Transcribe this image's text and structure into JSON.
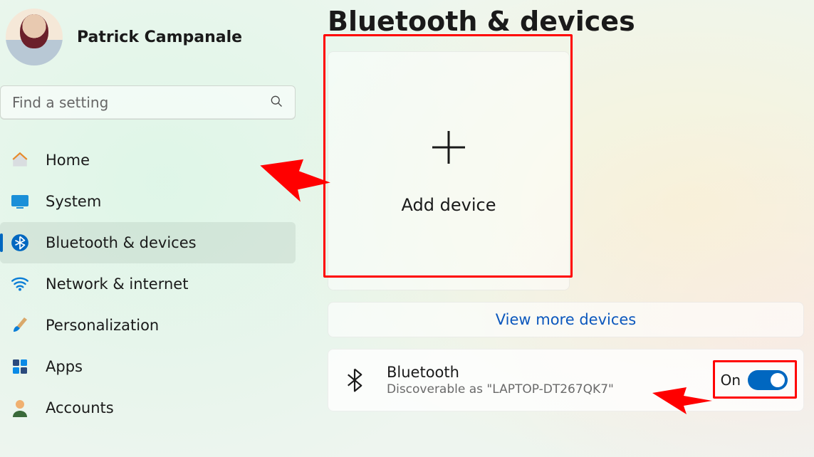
{
  "user": {
    "name": "Patrick Campanale"
  },
  "search": {
    "placeholder": "Find a setting"
  },
  "nav": {
    "items": [
      {
        "label": "Home"
      },
      {
        "label": "System"
      },
      {
        "label": "Bluetooth & devices"
      },
      {
        "label": "Network & internet"
      },
      {
        "label": "Personalization"
      },
      {
        "label": "Apps"
      },
      {
        "label": "Accounts"
      }
    ]
  },
  "page": {
    "title": "Bluetooth & devices"
  },
  "tile": {
    "addLabel": "Add device"
  },
  "viewMore": {
    "label": "View more devices"
  },
  "bluetooth": {
    "title": "Bluetooth",
    "subtitle": "Discoverable as \"LAPTOP-DT267QK7\"",
    "state": "On"
  }
}
